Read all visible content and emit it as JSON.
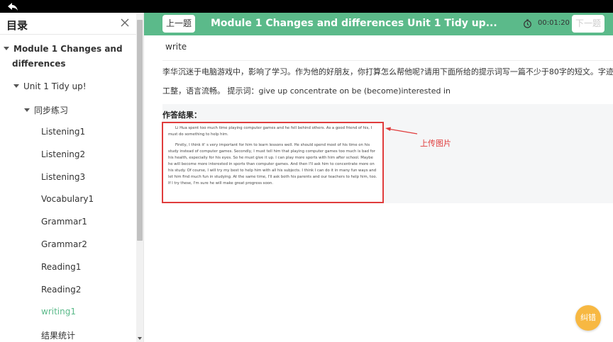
{
  "sidebar": {
    "title": "目录",
    "tree": {
      "module": "Module 1 Changes and",
      "module_line2": "differences",
      "unit": "Unit 1 Tidy up!",
      "section": "同步练习",
      "items": [
        "Listening1",
        "Listening2",
        "Listening3",
        "Vocabulary1",
        "Grammar1",
        "Grammar2",
        "Reading1",
        "Reading2",
        "writing1",
        "结果统计"
      ],
      "active_index": 8
    }
  },
  "header": {
    "prev_label": "上一题",
    "title": "Module 1 Changes and differences Unit 1 Tidy up...",
    "timer": "00:01:20",
    "next_label": "下一题"
  },
  "question": {
    "type": "write",
    "prompt_line1": "李华沉迷于电脑游戏中，影响了学习。作为他的好朋友，你打算怎么帮他呢?请用下面所给的提示词写一篇不少于80字的短文。字迹",
    "prompt_line2": "工整，语言流畅。 提示词：give up concentrate on be (become)interested in"
  },
  "answer": {
    "label": "作答结果：",
    "paragraph1": "Li Hua spent too much time playing computer games and he fell behind others. As a good friend of his, I must do something to help him.",
    "paragraph2": "Firstly, I think it' s very important for him to learn lessons well. He should spend most of his time on his study instead of computer games. Secondly, I must tell him that playing computer games too much is bad for his health, especially for his eyes. So he must give it up. I can play more sports with him after school. Maybe he will become more interested in sports than computer games. And then I'll ask him to concentrate more on his study. Of course, I will try my best to help him with all his subjects. I think I can do it in many fun ways and let him find much fun in studying. At the same time, I'll ask both his parents and our teachers to help him, too. If I try these, I'm sure he will make great progress soon.",
    "annotation": "上传图片"
  },
  "fix_button": "纠错",
  "colors": {
    "accent": "#5bba8a",
    "active_item": "#5bba8a",
    "highlight": "#e03c3c",
    "fab": "#f7b842"
  }
}
